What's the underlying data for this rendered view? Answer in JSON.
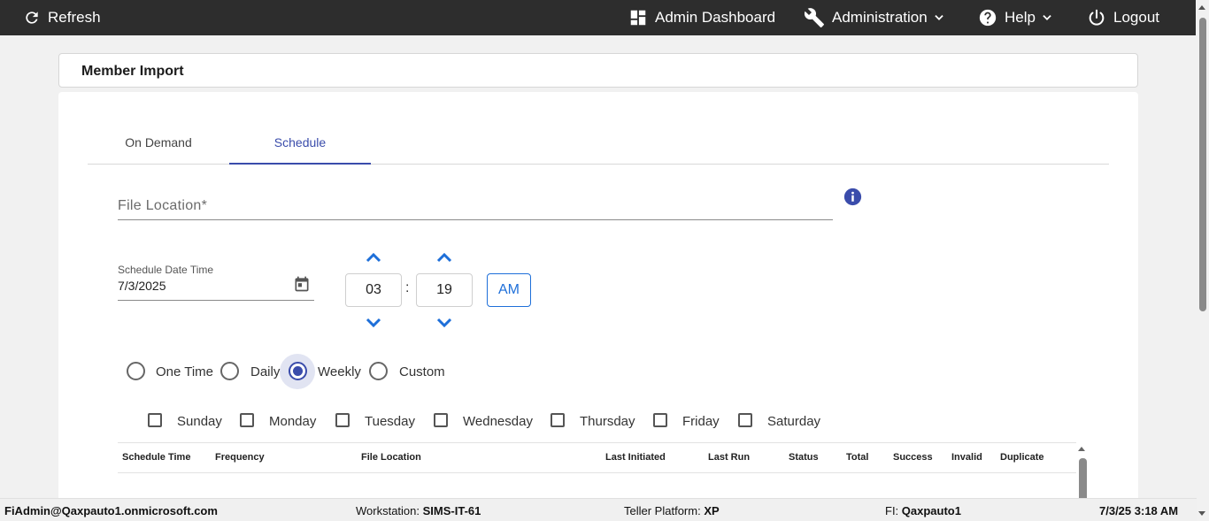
{
  "topbar": {
    "refresh": "Refresh",
    "admin_dashboard": "Admin Dashboard",
    "administration": "Administration",
    "help": "Help",
    "logout": "Logout"
  },
  "page": {
    "title": "Member Import"
  },
  "tabs": [
    {
      "label": "On Demand",
      "active": false
    },
    {
      "label": "Schedule",
      "active": true
    }
  ],
  "form": {
    "file_location_placeholder": "File Location*",
    "schedule_date_label": "Schedule Date Time",
    "schedule_date_value": "7/3/2025",
    "hour": "03",
    "minute": "19",
    "time_separator": ":",
    "ampm": "AM"
  },
  "frequency": {
    "options": [
      "One Time",
      "Daily",
      "Weekly",
      "Custom"
    ],
    "selected": "Weekly"
  },
  "days": [
    "Sunday",
    "Monday",
    "Tuesday",
    "Wednesday",
    "Thursday",
    "Friday",
    "Saturday"
  ],
  "table": {
    "headers": [
      "Schedule Time",
      "Frequency",
      "File Location",
      "Last Initiated",
      "Last Run",
      "Status",
      "Total",
      "Success",
      "Invalid",
      "Duplicate"
    ]
  },
  "footer": {
    "user": "FiAdmin@Qaxpauto1.onmicrosoft.com",
    "workstation_label": "Workstation: ",
    "workstation_value": "SIMS-IT-61",
    "teller_label": "Teller Platform: ",
    "teller_value": "XP",
    "fi_label": "FI: ",
    "fi_value": "Qaxpauto1",
    "datetime": "7/3/25 3:18 AM"
  },
  "colors": {
    "topbar": "#2d2d2d",
    "accent": "#3a4cab",
    "time_accent": "#1e6fd9"
  }
}
